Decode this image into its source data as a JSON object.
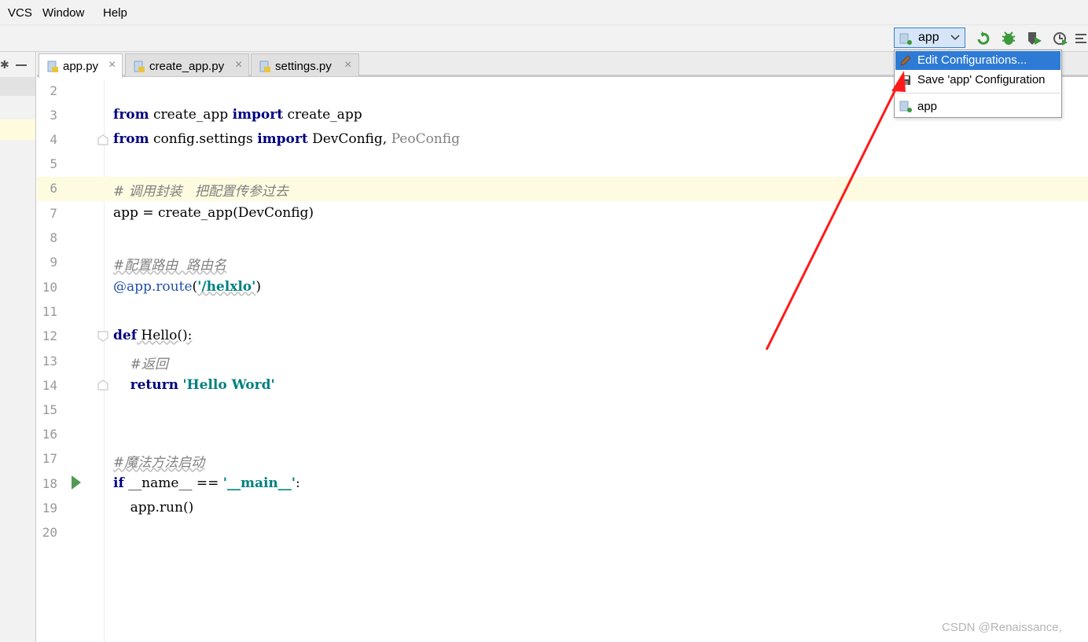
{
  "menu": {
    "vcs": "VCS",
    "window": "Window",
    "help": "Help"
  },
  "run_config": {
    "label": "app",
    "icon": "python-file-icon"
  },
  "toolbar_icons": [
    "rerun-icon",
    "debug-icon",
    "coverage-icon",
    "profile-icon",
    "more-icon"
  ],
  "tabs": [
    {
      "label": "app.py",
      "active": true
    },
    {
      "label": "create_app.py",
      "active": false
    },
    {
      "label": "settings.py",
      "active": false
    }
  ],
  "line_numbers": [
    "2",
    "3",
    "4",
    "5",
    "6",
    "7",
    "8",
    "9",
    "10",
    "11",
    "12",
    "13",
    "14",
    "15",
    "16",
    "17",
    "18",
    "19",
    "20"
  ],
  "code": {
    "l3": {
      "k1": "from",
      "t1": " create_app ",
      "k2": "import",
      "t2": " create_app"
    },
    "l4": {
      "k1": "from",
      "t1": " config.settings ",
      "k2": "import",
      "t2": " DevConfig, ",
      "dim": "PeoConfig"
    },
    "l6": {
      "comment": "# 调用封装   把配置传参过去"
    },
    "l7": {
      "text": "app = create_app(DevConfig)"
    },
    "l9": {
      "comment": "#配置路由  路由名"
    },
    "l10": {
      "deco": "@app.route",
      "p1": "(",
      "str": "'/helxlo'",
      "p2": ")"
    },
    "l12": {
      "kw": "def",
      "text": " Hello():"
    },
    "l13": {
      "comment": "    #返回"
    },
    "l14": {
      "indent": "    ",
      "kw": "return",
      "sp": " ",
      "str": "'Hello Word'"
    },
    "l17": {
      "comment": "#魔法方法启动"
    },
    "l18": {
      "kw": "if",
      "t1": " __name__ == ",
      "str": "'__main__'",
      "t2": ":"
    },
    "l19": {
      "text": "    app.run()"
    }
  },
  "dropdown": {
    "edit": "Edit Configurations...",
    "save": "Save 'app' Configuration",
    "app": "app"
  },
  "colors": {
    "selection": "#2e7bd6",
    "keyword": "#000080",
    "string": "#008080",
    "comment": "#808080",
    "arrow": "#ff1a1a"
  },
  "watermark": "CSDN @Renaissance,"
}
